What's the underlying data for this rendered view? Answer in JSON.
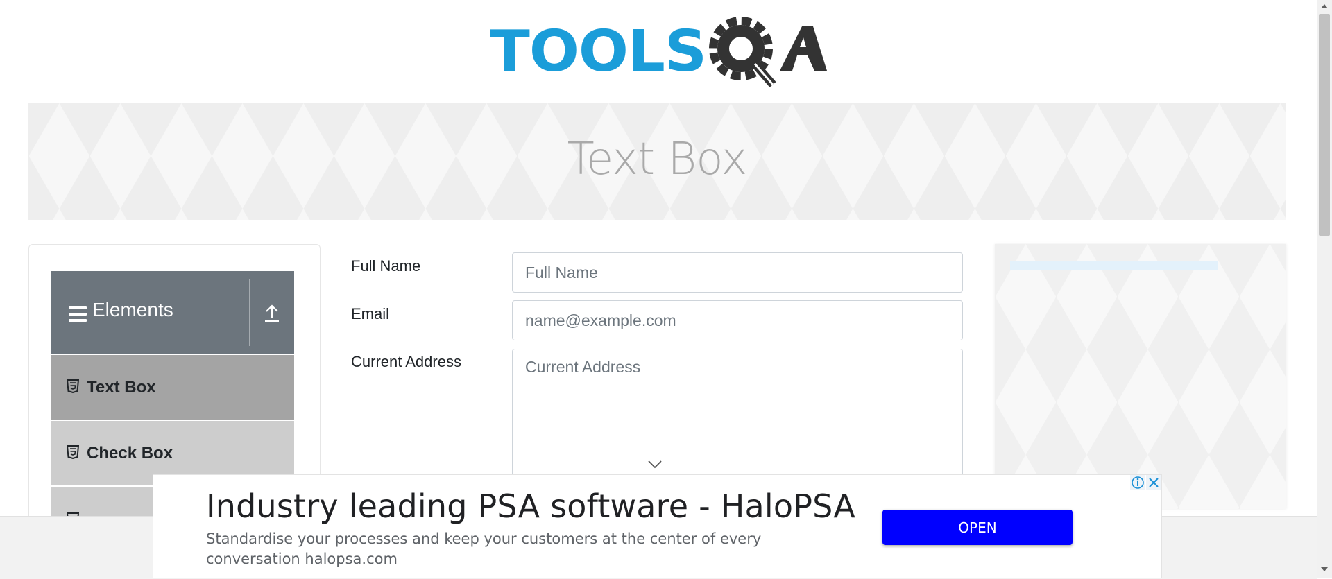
{
  "header": {
    "logo_text_left": "TOOLS",
    "logo_text_right": "QA"
  },
  "banner": {
    "title": "Text Box"
  },
  "sidebar": {
    "group_title": "Elements",
    "items": [
      {
        "label": "Text Box",
        "active": true
      },
      {
        "label": "Check Box",
        "active": false
      }
    ]
  },
  "form": {
    "full_name": {
      "label": "Full Name",
      "placeholder": "Full Name",
      "value": ""
    },
    "email": {
      "label": "Email",
      "placeholder": "name@example.com",
      "value": ""
    },
    "current_address": {
      "label": "Current Address",
      "placeholder": "Current Address",
      "value": ""
    }
  },
  "ad": {
    "headline": "Industry leading PSA software - HaloPSA",
    "description": "Standardise your processes and keep your customers at the center of every conversation halopsa.com",
    "button_label": "OPEN",
    "button_color": "#0000ff"
  },
  "colors": {
    "brand_blue": "#1b9dd9",
    "brand_dark": "#333333",
    "sidebar_header": "#6c757d"
  }
}
